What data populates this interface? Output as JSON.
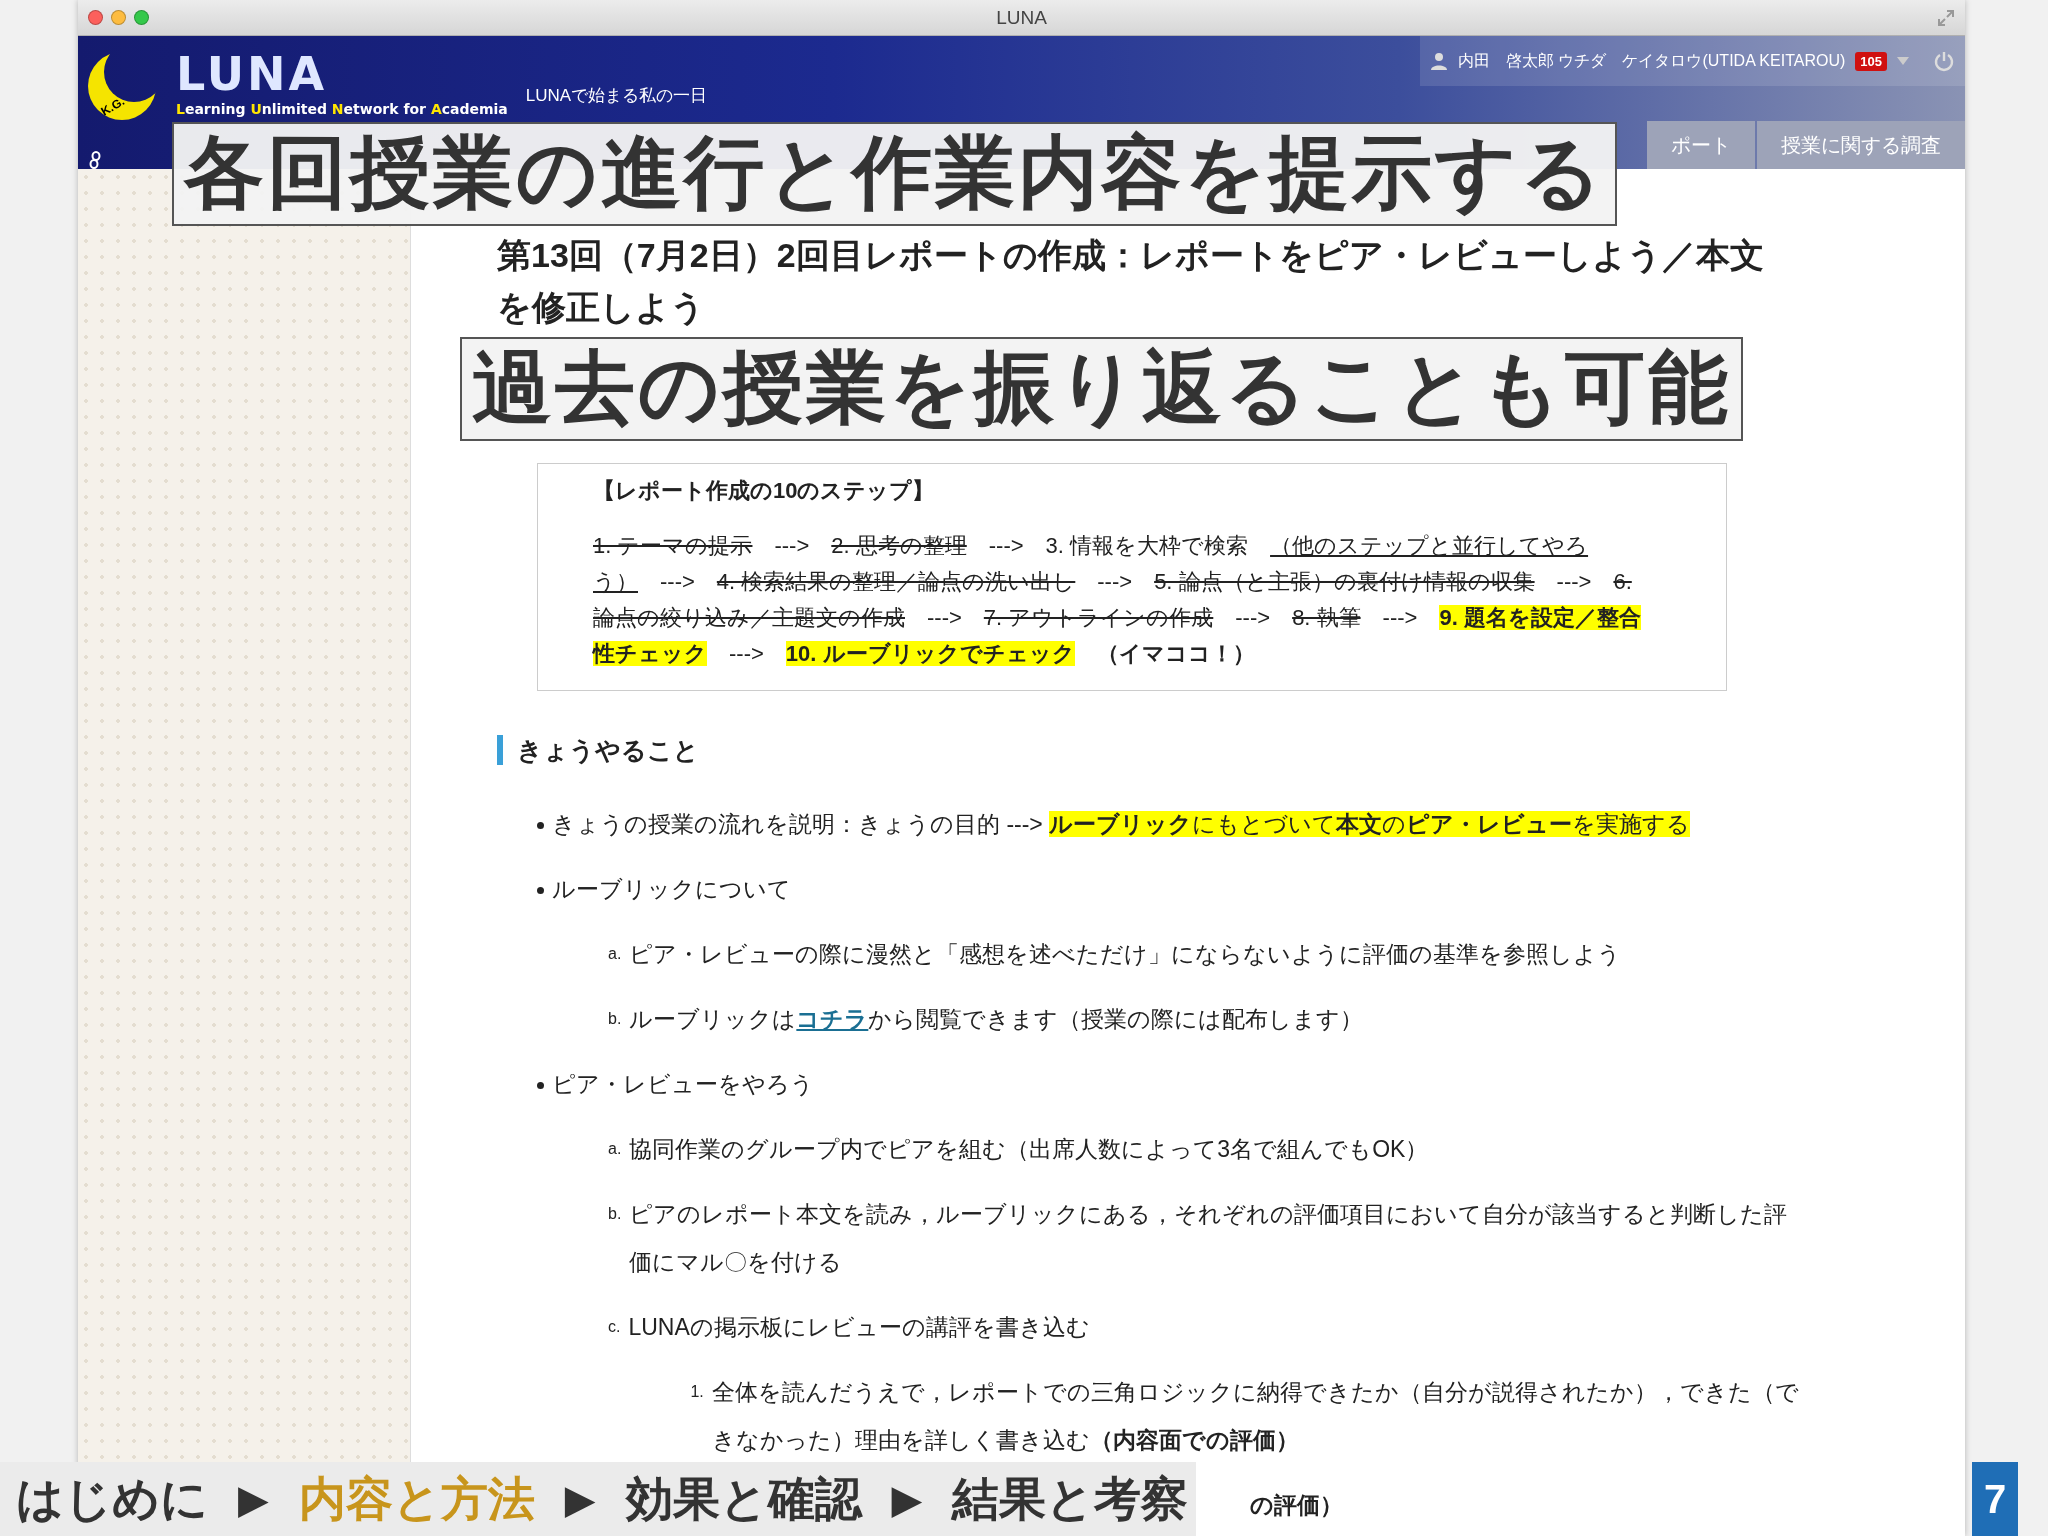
{
  "window": {
    "title": "LUNA"
  },
  "header": {
    "logo_mark": "K.G.",
    "logo": "LUNA",
    "tagline": "LUNAで始まる私の一日",
    "logo_subtitle": "**L**earning **U**nlimited **N**etwork for **A**cademia",
    "user": "内田　啓太郎 ウチダ　ケイタロウ(UTIDA KEITAROU)",
    "badge": "105"
  },
  "tabs": [
    {
      "label": "ポート",
      "selected": false
    },
    {
      "label": "授業に関する調査",
      "selected": false
    }
  ],
  "page": {
    "heading": "第13回（7月2日）2回目レポートの作成：レポートをピア・レビューしよう／本文を修正しよう",
    "steps_title": "【レポート作成の10のステップ】",
    "steps": [
      {
        "text": "1. テーマの提示",
        "kind": "done"
      },
      {
        "text": "--->",
        "kind": "arrow"
      },
      {
        "text": "2. 思考の整理",
        "kind": "done"
      },
      {
        "text": "--->",
        "kind": "arrow"
      },
      {
        "text": "3. 情報を大枠で検索",
        "kind": "ongoing"
      },
      {
        "text": "（他のステップと並行してやろう）",
        "kind": "note"
      },
      {
        "text": "--->",
        "kind": "arrow"
      },
      {
        "text": "4. 検索結果の整理／論点の洗い出し",
        "kind": "done"
      },
      {
        "text": "--->",
        "kind": "arrow"
      },
      {
        "text": "5. 論点（と主張）の裏付け情報の収集",
        "kind": "done"
      },
      {
        "text": "--->",
        "kind": "arrow"
      },
      {
        "text": "6. 論点の絞り込み／主題文の作成",
        "kind": "done"
      },
      {
        "text": "--->",
        "kind": "arrow"
      },
      {
        "text": "7. アウトラインの作成",
        "kind": "done"
      },
      {
        "text": "--->",
        "kind": "arrow"
      },
      {
        "text": "8. 執筆",
        "kind": "done"
      },
      {
        "text": "--->",
        "kind": "arrow"
      },
      {
        "text": "9. 題名を設定／整合性チェック",
        "kind": "current"
      },
      {
        "text": "--->",
        "kind": "arrow"
      },
      {
        "text": "10. ルーブリックでチェック",
        "kind": "current"
      },
      {
        "text": "（イマココ！）",
        "kind": "marker"
      }
    ],
    "section_title": "きょうやること",
    "items": [
      {
        "text": "きょうの授業の流れを説明：きょうの目的 --->",
        "highlighted_text": "**ルーブリック**にもとづいて**本文**の**ピア・レビュー**を実施する"
      },
      {
        "text": "ルーブリックについて",
        "children": [
          {
            "marker": "a.",
            "text": "ピア・レビューの際に漫然と「感想を述べただけ」にならないように評価の基準を参照しよう"
          },
          {
            "marker": "b.",
            "text": "ルーブリックは",
            "link": "コチラ",
            "text_after": "から閲覧できます（授業の際には配布します）"
          }
        ]
      },
      {
        "text": "ピア・レビューをやろう",
        "children": [
          {
            "marker": "a.",
            "text": "協同作業のグループ内でピアを組む（出席人数によって3名で組んでもOK）"
          },
          {
            "marker": "b.",
            "text": "ピアのレポート本文を読み，ルーブリックにある，それぞれの評価項目において自分が該当すると判断した評価にマル〇を付ける"
          },
          {
            "marker": "c.",
            "text": "LUNAの掲示板にレビューの講評を書き込む",
            "children": [
              {
                "marker": "1.",
                "text": "全体を読んだうえで，レポートでの三角ロジックに納得できたか（自分が説得されたか），できた（できなかった）理由を詳しく書き込む**（内容面での評価）**"
              },
              {
                "text": "**の評価）**"
              }
            ]
          }
        ]
      }
    ]
  },
  "captions": [
    "各回授業の進行と作業内容を提示する",
    "過去の授業を振り返ることも可能"
  ],
  "slide_nav": {
    "separator": "▶",
    "items": [
      {
        "label": "はじめに",
        "selected": false
      },
      {
        "label": "内容と方法",
        "selected": true
      },
      {
        "label": "効果と確認",
        "selected": false
      },
      {
        "label": "結果と考察",
        "selected": false
      }
    ]
  },
  "page_number": "7"
}
